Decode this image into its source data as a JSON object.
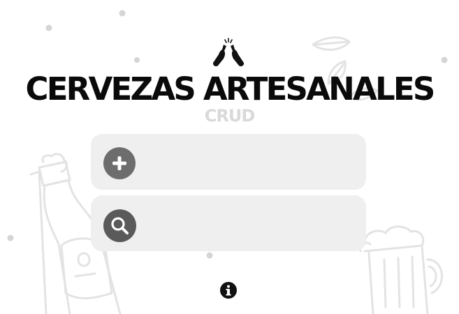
{
  "header": {
    "title": "CERVEZAS ARTESANALES",
    "subtitle": "CRUD",
    "logo_icon": "beer-bottles-toast-icon"
  },
  "actions": [
    {
      "name": "add",
      "icon": "plus-icon",
      "label": ""
    },
    {
      "name": "search",
      "icon": "search-icon",
      "label": ""
    }
  ],
  "footer": {
    "info_icon": "info-icon"
  },
  "colors": {
    "title": "#0a0a0a",
    "subtitle": "#d9d9d9",
    "card_bg": "#efefef",
    "icon_bg_add": "#6d6d6d",
    "icon_bg_search": "#5a5a5a",
    "background_art": "#e3e3e3"
  }
}
